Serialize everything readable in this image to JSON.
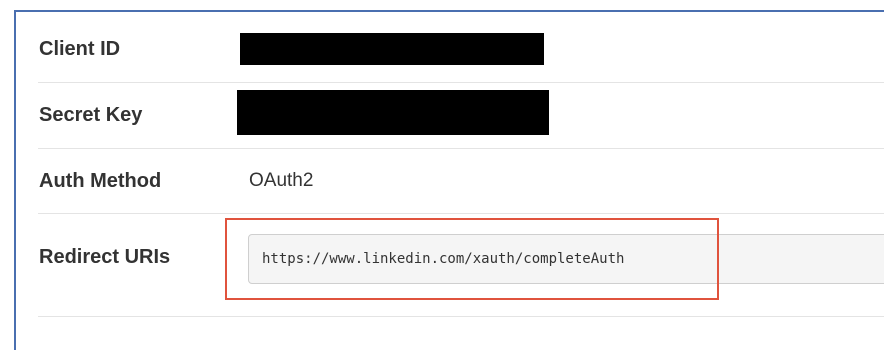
{
  "fields": {
    "client_id": {
      "label": "Client ID"
    },
    "secret_key": {
      "label": "Secret Key"
    },
    "auth_method": {
      "label": "Auth Method",
      "value": "OAuth2"
    },
    "redirect_uris": {
      "label": "Redirect URIs",
      "value": "https://www.linkedin.com/xauth/completeAuth"
    }
  },
  "colors": {
    "panel_border": "#4a6fb0",
    "highlight": "#e0533d",
    "redaction": "#000000",
    "field_background": "#f5f5f5"
  }
}
